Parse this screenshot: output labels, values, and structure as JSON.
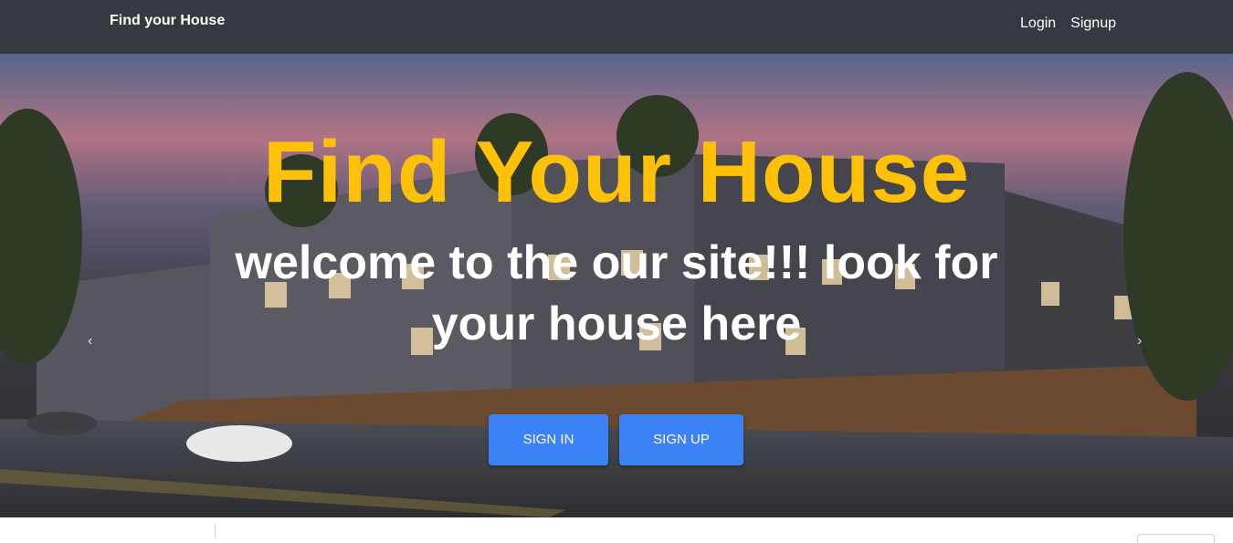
{
  "navbar": {
    "brand": "Find your House",
    "links": [
      {
        "label": "Login"
      },
      {
        "label": "Signup"
      }
    ]
  },
  "hero": {
    "title": "Find Your House",
    "subtitle": "welcome to the our site!!! look for your house here",
    "buttons": {
      "signin": "SIGN IN",
      "signup": "SIGN UP"
    },
    "prev_icon": "chevron-left-icon",
    "next_icon": "chevron-right-icon"
  },
  "colors": {
    "navbar_bg": "#343a40",
    "title_color": "#ffc107",
    "button_bg": "#3b82f6",
    "text_white": "#ffffff"
  }
}
